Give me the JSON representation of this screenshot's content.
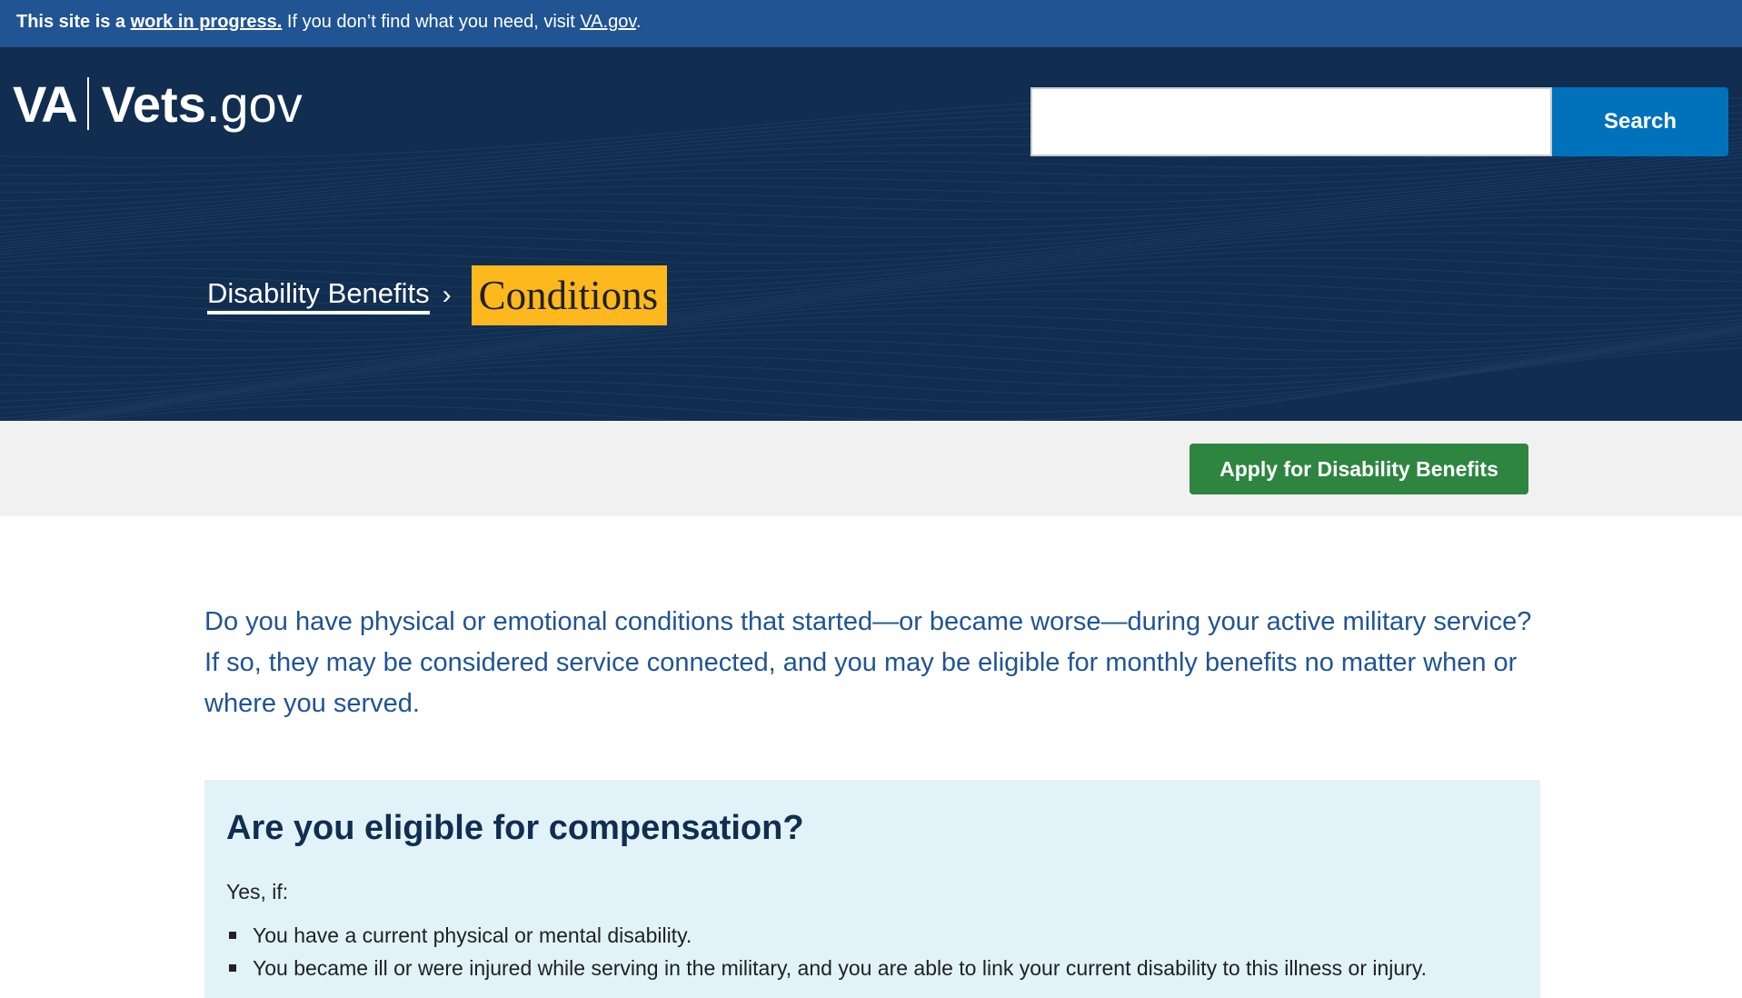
{
  "notice": {
    "prefix": "This site is a",
    "link": "work in progress.",
    "middle": "If you don’t find what you need, visit",
    "va_link": "VA.gov",
    "suffix": "."
  },
  "header": {
    "logo": {
      "va": "VA",
      "vets": "Vets",
      "gov": ".gov"
    },
    "search": {
      "value": "",
      "placeholder": "",
      "button_label": "Search"
    }
  },
  "breadcrumb": {
    "parent": "Disability Benefits",
    "separator": "›",
    "current": "Conditions"
  },
  "actions": {
    "apply_label": "Apply for Disability Benefits"
  },
  "main": {
    "lead": "Do you have physical or emotional conditions that started—or became worse—during your active military service? If so, they may be considered service connected, and you may be eligible for monthly benefits no matter when or where you served.",
    "eligibility": {
      "heading": "Are you eligible for compensation?",
      "intro": "Yes, if:",
      "items": [
        "You have a current physical or mental disability.",
        "You became ill or were injured while serving in the military, and you are able to link your current disability to this illness or injury."
      ]
    }
  },
  "colors": {
    "notice_bg": "#205493",
    "hero_bg": "#112e51",
    "search_button": "#0071bb",
    "highlight": "#fdb81e",
    "apply_button": "#2e8540",
    "callout_bg": "#e1f3f8",
    "lead_text": "#205493"
  }
}
